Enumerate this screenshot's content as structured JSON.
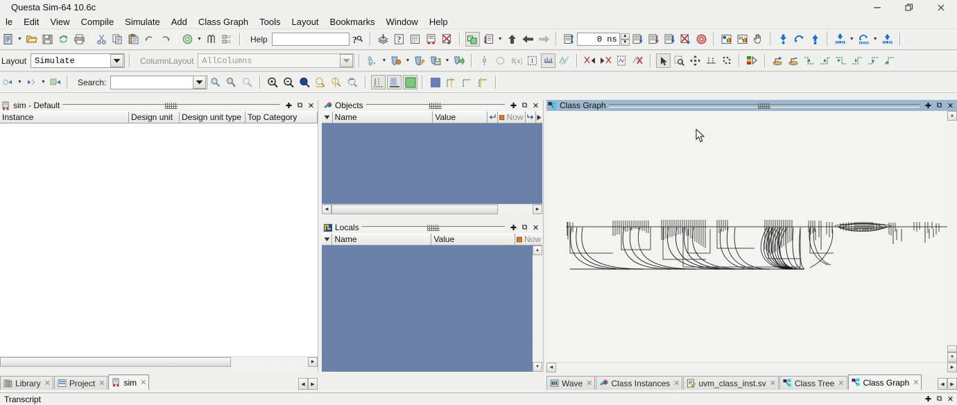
{
  "window": {
    "title": "Questa Sim-64 10.6c",
    "controls": [
      {
        "name": "minimize",
        "glyph": "—"
      },
      {
        "name": "restore",
        "glyph": "❐"
      },
      {
        "name": "close",
        "glyph": "✕"
      }
    ]
  },
  "menubar": {
    "items": [
      {
        "label": "le"
      },
      {
        "label": "Edit"
      },
      {
        "label": "View"
      },
      {
        "label": "Compile"
      },
      {
        "label": "Simulate"
      },
      {
        "label": "Add"
      },
      {
        "label": "Class Graph"
      },
      {
        "label": "Tools"
      },
      {
        "label": "Layout"
      },
      {
        "label": "Bookmarks"
      },
      {
        "label": "Window"
      },
      {
        "label": "Help"
      }
    ]
  },
  "toolbar_main": {
    "help_label": "Help",
    "help_value": "",
    "time_value": "0  ns",
    "icons": [
      "new-file-icon",
      "open-folder-icon",
      "save-icon",
      "reload-icon",
      "print-icon",
      "cut-icon",
      "copy-icon",
      "paste-icon",
      "undo-icon",
      "redo-icon",
      "compile-icon",
      "find-icon",
      "find-options-icon",
      "help-search-icon",
      "compile-all-icon",
      "compile-order-icon",
      "simulate-icon",
      "simulate-opt-icon",
      "break-icon",
      "restart-icon",
      "run-icon",
      "continue-icon",
      "step-back-icon",
      "step-forward-icon",
      "run-length-icon",
      "step-into-icon",
      "step-over-icon",
      "step-out-icon",
      "stop-icon",
      "break-all-icon",
      "profile-icon",
      "memory-profile-icon",
      "hand-pan-icon",
      "down-arrow-icon",
      "loop-arrow-icon",
      "up-arrow-icon",
      "down-wave-icon",
      "loop-wave-icon",
      "up-wave-icon"
    ]
  },
  "toolbar_layout": {
    "layout_label": "Layout",
    "layout_value": "Simulate",
    "columnlayout_label": "ColumnLayout",
    "columnlayout_value": "AllColumns",
    "icons": [
      "wave-add-icon",
      "bookmark-add-icon",
      "bookmark-edit-icon",
      "bookmark-save-icon",
      "bookmark-go-icon",
      "cursor-insert-icon",
      "circle-icon",
      "expr-icon",
      "select-region-icon",
      "align-icon",
      "wave-zoom-icon",
      "cut-left-icon",
      "cut-right-icon",
      "copy-wave-icon",
      "delete-wave-icon",
      "pointer-icon",
      "zoom-select-icon",
      "pan-icon",
      "measure-icon",
      "grid-icon",
      "colors-icon",
      "schematic-add-icon",
      "schematic-remove-icon",
      "net-in-icon",
      "net-out-icon",
      "net-down-icon",
      "net-up-icon",
      "net-left-icon",
      "net-right-icon"
    ]
  },
  "toolbar_search": {
    "search_label": "Search:",
    "search_value": "",
    "search_placeholder": "",
    "icons": [
      "expand-icon",
      "collapse-icon",
      "expand-all-icon",
      "find-prev-icon",
      "find-next-icon",
      "find-all-icon",
      "zoom-in-icon",
      "zoom-out-icon",
      "zoom-full-icon",
      "zoom-range-icon",
      "zoom-cursor-icon",
      "zoom-last-icon",
      "grid-small-icon",
      "grid-med-icon",
      "grid-large-icon",
      "grid-dense-icon",
      "step-shape-icon",
      "step-shape2-icon",
      "step-shape3-icon"
    ]
  },
  "panels": {
    "sim": {
      "title": "sim - Default",
      "icon": "sim-icon",
      "active": false,
      "columns": [
        "Instance",
        "Design unit",
        "Design unit type",
        "Top Category"
      ],
      "rows": [],
      "buttons": [
        {
          "name": "dock-add-button",
          "glyph": "✚"
        },
        {
          "name": "undock-button",
          "glyph": "⧉"
        },
        {
          "name": "close-panel-button",
          "glyph": "✕"
        }
      ]
    },
    "objects": {
      "title": "Objects",
      "icon": "objects-icon",
      "active": false,
      "columns": [
        "Name",
        "Value"
      ],
      "now_label": "Now",
      "rows": [],
      "buttons": [
        {
          "name": "dock-add-button",
          "glyph": "✚"
        },
        {
          "name": "undock-button",
          "glyph": "⧉"
        },
        {
          "name": "close-panel-button",
          "glyph": "✕"
        }
      ]
    },
    "locals": {
      "title": "Locals",
      "icon": "locals-icon",
      "active": false,
      "columns": [
        "Name",
        "Value"
      ],
      "now_label": "Now",
      "rows": [],
      "buttons": [
        {
          "name": "dock-add-button",
          "glyph": "✚"
        },
        {
          "name": "undock-button",
          "glyph": "⧉"
        },
        {
          "name": "close-panel-button",
          "glyph": "✕"
        }
      ]
    },
    "classgraph": {
      "title": "Class Graph",
      "icon": "class-graph-icon",
      "active": true,
      "buttons": [
        {
          "name": "dock-add-button",
          "glyph": "✚"
        },
        {
          "name": "undock-button",
          "glyph": "⧉"
        },
        {
          "name": "close-panel-button",
          "glyph": "✕"
        }
      ]
    }
  },
  "tabs_left": [
    {
      "label": "Library",
      "icon": "library-icon",
      "active": false
    },
    {
      "label": "Project",
      "icon": "project-icon",
      "active": false
    },
    {
      "label": "sim",
      "icon": "sim-icon",
      "active": true
    }
  ],
  "tabs_right": [
    {
      "label": "Wave",
      "icon": "wave-icon",
      "active": false
    },
    {
      "label": "Class Instances",
      "icon": "objects-icon",
      "active": false
    },
    {
      "label": "uvm_class_inst.sv",
      "icon": "source-file-icon",
      "active": false
    },
    {
      "label": "Class Tree",
      "icon": "class-graph-icon",
      "active": false
    },
    {
      "label": "Class Graph",
      "icon": "class-graph-icon",
      "active": true
    }
  ],
  "status": {
    "transcript_label": "Transcript"
  },
  "colors": {
    "window_bg": "#f0f0ef",
    "panel_title_active": "#9db7cf",
    "list_bg": "#6a80a8",
    "canvas_bg": "#f3f3f1",
    "accent_blue": "#1a5fb4",
    "now_orange": "#e07820"
  }
}
